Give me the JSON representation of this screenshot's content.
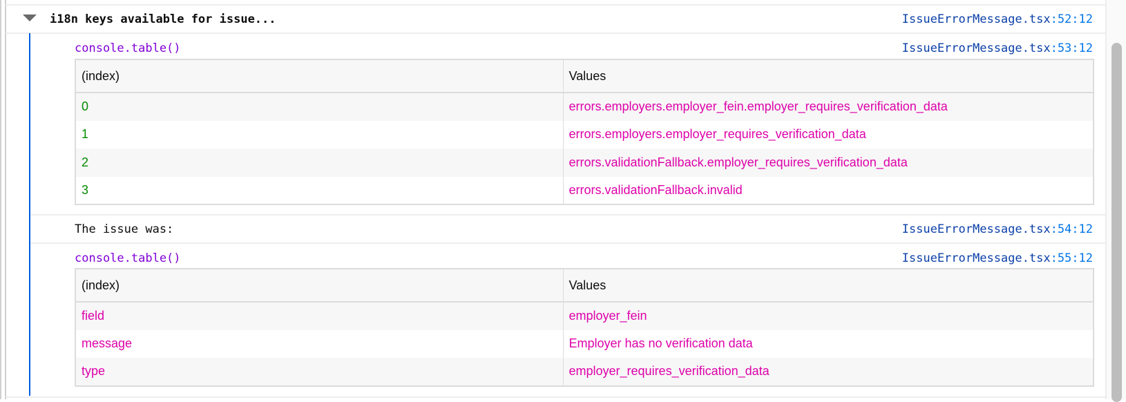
{
  "group": {
    "title": "i18n keys available for issue...",
    "file": "IssueErrorMessage.tsx",
    "pos": ":52:12",
    "expanded": true
  },
  "table1": {
    "label": "console.table()",
    "file": "IssueErrorMessage.tsx",
    "pos": ":53:12",
    "headers": [
      "(index)",
      "Values"
    ],
    "rows": [
      [
        "0",
        "errors.employers.employer_fein.employer_requires_verification_data"
      ],
      [
        "1",
        "errors.employers.employer_requires_verification_data"
      ],
      [
        "2",
        "errors.validationFallback.employer_requires_verification_data"
      ],
      [
        "3",
        "errors.validationFallback.invalid"
      ]
    ]
  },
  "log": {
    "text": "The issue was:",
    "file": "IssueErrorMessage.tsx",
    "pos": ":54:12"
  },
  "table2": {
    "label": "console.table()",
    "file": "IssueErrorMessage.tsx",
    "pos": ":55:12",
    "headers": [
      "(index)",
      "Values"
    ],
    "rows": [
      [
        "field",
        "employer_fein"
      ],
      [
        "message",
        "Employer has no verification data"
      ],
      [
        "type",
        "employer_requires_verification_data"
      ]
    ]
  },
  "colors": {
    "index_numeric": "#058b00",
    "string_value": "#dd00a9",
    "console_table": "#8000d7",
    "group_bar": "#0060df"
  }
}
